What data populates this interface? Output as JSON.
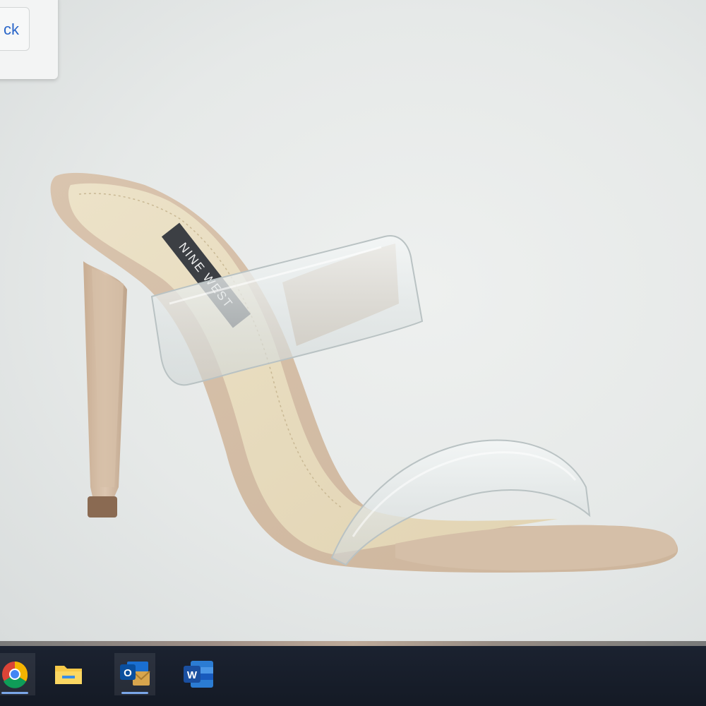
{
  "popup": {
    "button_label": "ck"
  },
  "product": {
    "brand_label": "NINE WEST",
    "colors": {
      "suede": "#d8c3ad",
      "insole": "#e8dcc0",
      "strap": "#e9eeee"
    }
  },
  "taskbar": {
    "items": [
      {
        "name": "chrome",
        "icon": "chrome-icon",
        "active": true
      },
      {
        "name": "file-explorer",
        "icon": "folder-icon",
        "active": false
      },
      {
        "name": "outlook",
        "icon": "outlook-icon",
        "active": true
      },
      {
        "name": "word",
        "icon": "word-icon",
        "active": false
      }
    ]
  }
}
